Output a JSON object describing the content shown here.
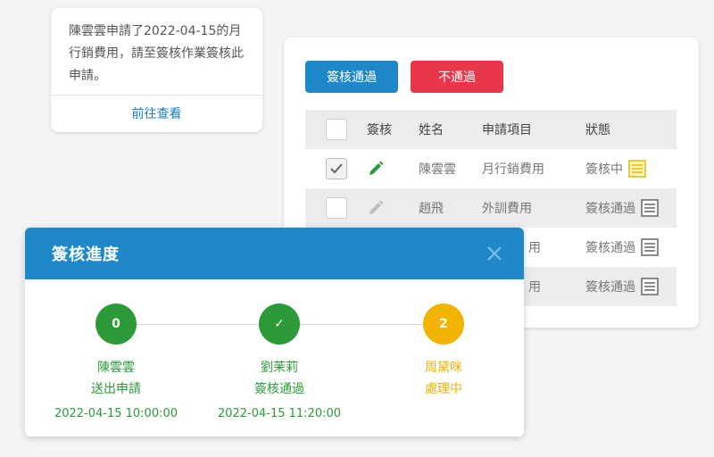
{
  "notification": {
    "message": "陳雲雲申請了2022-04-15的月行銷費用，請至簽核作業簽核此申請。",
    "link_label": "前往查看"
  },
  "review_panel": {
    "approve_label": "簽核通過",
    "reject_label": "不通過",
    "columns": [
      "簽核",
      "姓名",
      "申請項目",
      "狀態"
    ],
    "rows": [
      {
        "checked": true,
        "editable": true,
        "name": "陳雲雲",
        "item": "月行銷費用",
        "status": "簽核中",
        "status_icon": "list-doc-icon-yellow"
      },
      {
        "checked": false,
        "editable": false,
        "name": "趙飛",
        "item": "外訓費用",
        "status": "簽核通過",
        "status_icon": "list-doc-icon"
      },
      {
        "checked": false,
        "editable": false,
        "name": "",
        "item": "用",
        "status": "簽核通過",
        "status_icon": "list-doc-icon"
      },
      {
        "checked": false,
        "editable": false,
        "name": "",
        "item": "用",
        "status": "簽核通過",
        "status_icon": "list-doc-icon"
      }
    ]
  },
  "dialog": {
    "title": "簽核進度",
    "steps": [
      {
        "badge": "0",
        "name": "陳雲雲",
        "action": "送出申請",
        "time": "2022-04-15  10:00:00",
        "state": "done"
      },
      {
        "badge": "✓",
        "name": "劉茉莉",
        "action": "簽核通過",
        "time": "2022-04-15  11:20:00",
        "state": "done"
      },
      {
        "badge": "2",
        "name": "周黛咪",
        "action": "處理中",
        "time": "",
        "state": "current"
      }
    ]
  },
  "colors": {
    "primary": "#1e88c8",
    "danger": "#e9374a",
    "success": "#2d9a3a",
    "warning": "#f2b400"
  }
}
